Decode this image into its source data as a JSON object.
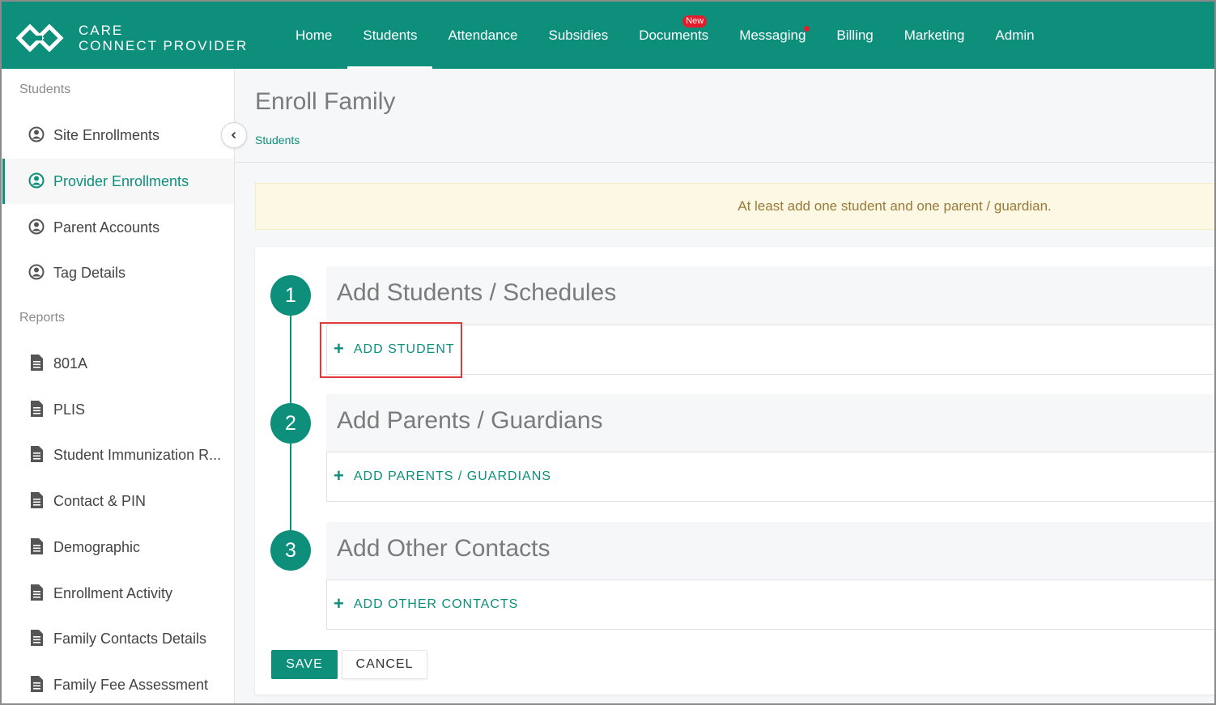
{
  "brand": {
    "line1": "CARE",
    "line2": "CONNECT PROVIDER"
  },
  "nav": {
    "items": [
      {
        "label": "Home"
      },
      {
        "label": "Students",
        "active": true
      },
      {
        "label": "Attendance"
      },
      {
        "label": "Subsidies"
      },
      {
        "label": "Documents",
        "badge": "New"
      },
      {
        "label": "Messaging",
        "notification_dot": true
      },
      {
        "label": "Billing"
      },
      {
        "label": "Marketing"
      },
      {
        "label": "Admin"
      }
    ]
  },
  "sidebar": {
    "students_heading": "Students",
    "student_items": [
      {
        "label": "Site Enrollments",
        "icon": "user-circle-icon"
      },
      {
        "label": "Provider Enrollments",
        "icon": "user-circle-icon",
        "active": true
      },
      {
        "label": "Parent Accounts",
        "icon": "user-circle-icon"
      },
      {
        "label": "Tag Details",
        "icon": "user-circle-icon"
      }
    ],
    "reports_heading": "Reports",
    "report_items": [
      {
        "label": "801A",
        "icon": "document-icon"
      },
      {
        "label": "PLIS",
        "icon": "document-icon"
      },
      {
        "label": "Student Immunization R...",
        "icon": "document-icon"
      },
      {
        "label": "Contact & PIN",
        "icon": "document-icon"
      },
      {
        "label": "Demographic",
        "icon": "document-icon"
      },
      {
        "label": "Enrollment Activity",
        "icon": "document-icon"
      },
      {
        "label": "Family Contacts Details",
        "icon": "document-icon"
      },
      {
        "label": "Family Fee Assessment",
        "icon": "document-icon"
      }
    ]
  },
  "page": {
    "title": "Enroll Family",
    "breadcrumb": "Students",
    "alert": "At least add one student and one parent / guardian."
  },
  "steps": [
    {
      "number": "1",
      "title": "Add Students / Schedules",
      "action": "ADD STUDENT"
    },
    {
      "number": "2",
      "title": "Add Parents / Guardians",
      "action": "ADD PARENTS / GUARDIANS"
    },
    {
      "number": "3",
      "title": "Add Other Contacts",
      "action": "ADD OTHER CONTACTS"
    }
  ],
  "actions": {
    "save": "SAVE",
    "cancel": "CANCEL"
  },
  "colors": {
    "brand_teal": "#0d8f7c",
    "alert_bg": "#fcf8e3",
    "alert_text": "#9a7a3a",
    "badge_red": "#e61c2a",
    "highlight_red": "#e23a3a"
  }
}
